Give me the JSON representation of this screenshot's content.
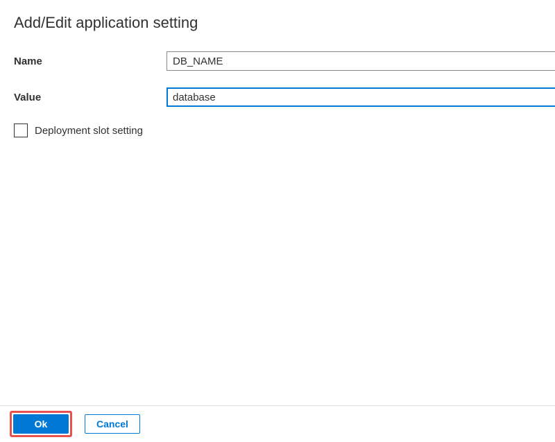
{
  "panel": {
    "title": "Add/Edit application setting"
  },
  "form": {
    "name_label": "Name",
    "name_value": "DB_NAME",
    "value_label": "Value",
    "value_value": "database",
    "slot_label": "Deployment slot setting"
  },
  "footer": {
    "ok_label": "Ok",
    "cancel_label": "Cancel"
  }
}
